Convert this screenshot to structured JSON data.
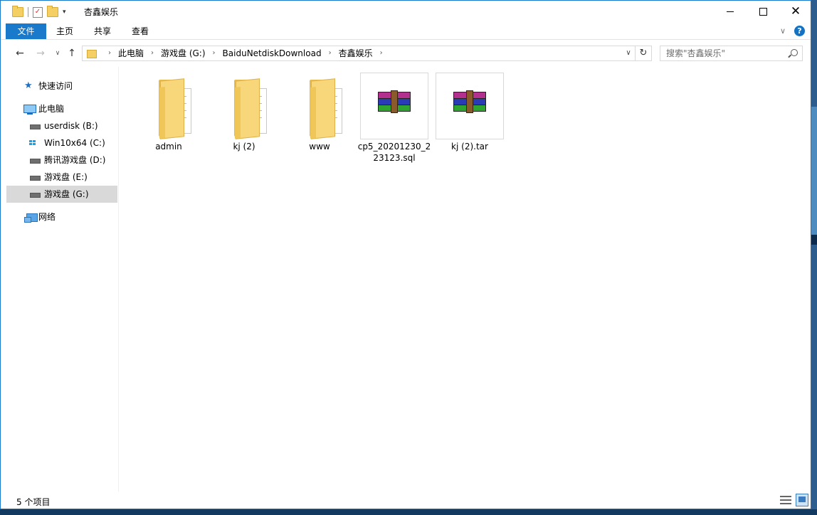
{
  "window": {
    "title": "杏鑫娱乐"
  },
  "ribbon": {
    "tabs": [
      "文件",
      "主页",
      "共享",
      "查看"
    ],
    "help_label": "?"
  },
  "address": {
    "crumbs": [
      "此电脑",
      "游戏盘 (G:)",
      "BaiduNetdiskDownload",
      "杏鑫娱乐"
    ]
  },
  "search": {
    "placeholder": "搜索\"杏鑫娱乐\""
  },
  "sidebar": {
    "quick_access": "快速访问",
    "this_pc": "此电脑",
    "drives": [
      {
        "label": "userdisk (B:)"
      },
      {
        "label": "Win10x64 (C:)"
      },
      {
        "label": "腾讯游戏盘 (D:)"
      },
      {
        "label": "游戏盘 (E:)"
      },
      {
        "label": "游戏盘 (G:)",
        "selected": true
      }
    ],
    "network": "网络"
  },
  "files": [
    {
      "name": "admin",
      "type": "folder"
    },
    {
      "name": "kj (2)",
      "type": "folder"
    },
    {
      "name": "www",
      "type": "folder"
    },
    {
      "name": "cp5_20201230_223123.sql",
      "type": "archive"
    },
    {
      "name": "kj (2).tar",
      "type": "archive"
    }
  ],
  "status": {
    "item_count": "5 个项目"
  },
  "colors": {
    "accent": "#1979ca",
    "folder": "#f8d77a"
  }
}
